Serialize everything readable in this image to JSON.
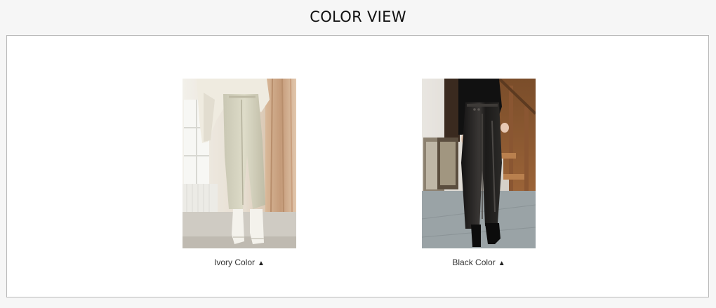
{
  "section": {
    "title": "COLOR VIEW"
  },
  "items": [
    {
      "caption": "Ivory Color",
      "arrow": "▲",
      "swatch": "#d9d6c4"
    },
    {
      "caption": "Black Color",
      "arrow": "▲",
      "swatch": "#1c1a19"
    }
  ]
}
